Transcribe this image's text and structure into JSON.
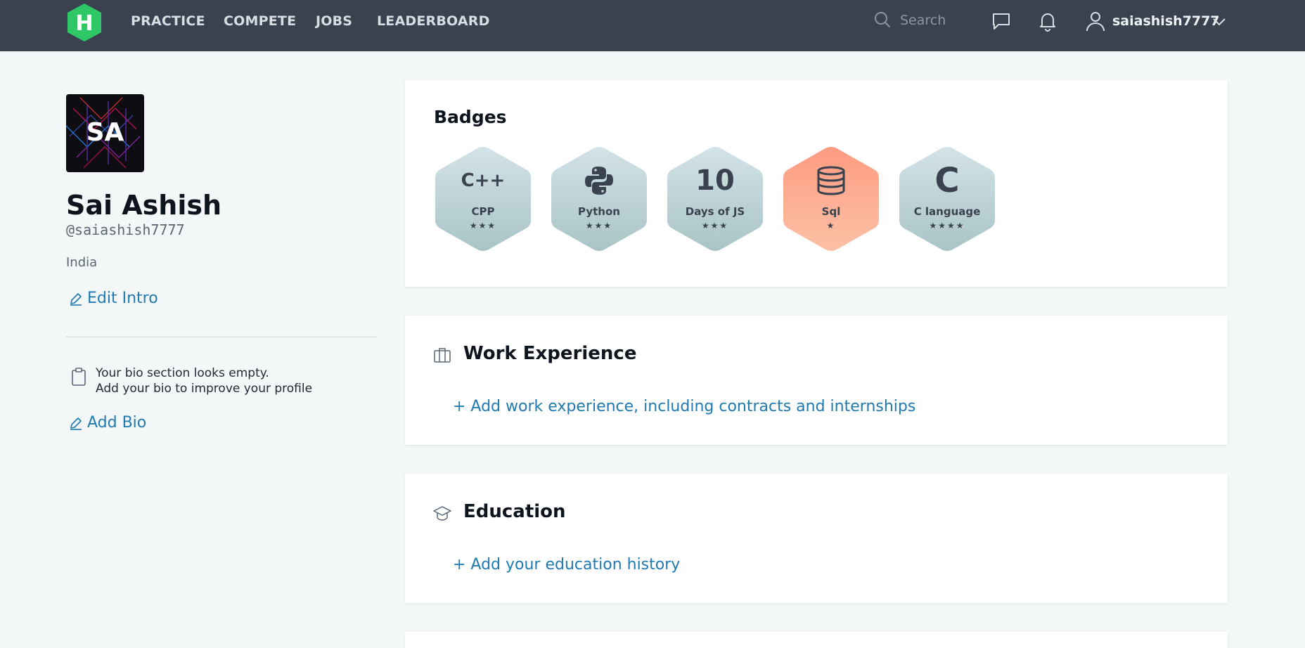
{
  "nav": {
    "links": [
      "PRACTICE",
      "COMPETE",
      "JOBS",
      "LEADERBOARD"
    ],
    "search_placeholder": "Search",
    "username": "saiashish7777",
    "logo_letter": "H",
    "logo_color": "#2ec866",
    "icons": [
      "search-icon",
      "message-icon",
      "bell-icon",
      "user-icon",
      "chevron-down-icon"
    ]
  },
  "profile": {
    "initials": "SA",
    "name": "Sai Ashish",
    "handle": "@saiashish7777",
    "country": "India",
    "edit_intro": "Edit Intro",
    "bio_empty_line1": "Your bio section looks empty.",
    "bio_empty_line2": "Add your bio to improve your profile",
    "add_bio": "Add Bio"
  },
  "badges": {
    "title": "Badges",
    "items": [
      {
        "label": "CPP",
        "glyph": "C++",
        "stars": "★★★",
        "color": "silver"
      },
      {
        "label": "Python",
        "glyph": "python-icon",
        "stars": "★★★",
        "color": "silver"
      },
      {
        "label": "Days of JS",
        "glyph": "10",
        "stars": "★★★",
        "color": "silver"
      },
      {
        "label": "Sql",
        "glyph": "database-icon",
        "stars": "★",
        "color": "bronze"
      },
      {
        "label": "C language",
        "glyph": "C",
        "stars": "★★★★",
        "color": "silver"
      }
    ]
  },
  "work": {
    "title": "Work Experience",
    "add_link": "+ Add work experience, including contracts and internships"
  },
  "education": {
    "title": "Education",
    "add_link": "+ Add your education history"
  },
  "colors": {
    "nav_bg": "#39424e",
    "page_bg": "#f3f7f7",
    "link": "#1f7ab2",
    "badge_silver": "#c3d6da",
    "badge_bronze": "#fca98a"
  }
}
